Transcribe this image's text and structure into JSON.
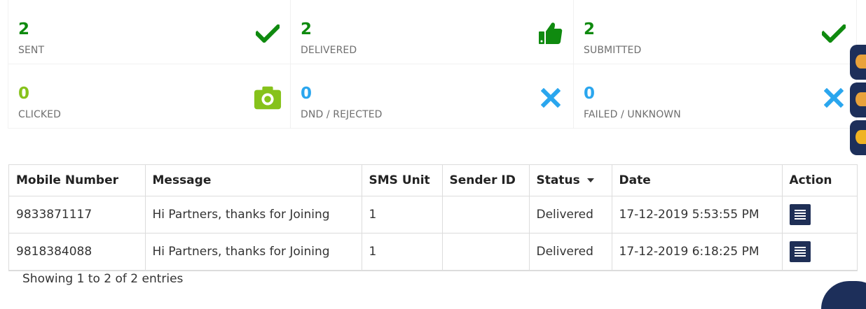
{
  "stats": [
    {
      "value": "2",
      "label": "SENT",
      "icon": "checkmark-icon",
      "color": "#0f8a0f"
    },
    {
      "value": "2",
      "label": "DELIVERED",
      "icon": "thumbs-up-icon",
      "color": "#0f8a0f"
    },
    {
      "value": "2",
      "label": "SUBMITTED",
      "icon": "checkmark-icon",
      "color": "#0f8a0f"
    },
    {
      "value": "0",
      "label": "CLICKED",
      "icon": "camera-icon",
      "color": "#86c21b"
    },
    {
      "value": "0",
      "label": "DND / REJECTED",
      "icon": "x-icon",
      "color": "#2aa6ee"
    },
    {
      "value": "0",
      "label": "FAILED / UNKNOWN",
      "icon": "x-icon",
      "color": "#2aa6ee"
    }
  ],
  "table": {
    "columns": [
      "Mobile Number",
      "Message",
      "SMS Unit",
      "Sender ID",
      "Status",
      "Date",
      "Action"
    ],
    "sorted_column": "Status",
    "rows": [
      {
        "mobile": "9833871117",
        "message": "Hi Partners, thanks for Joining",
        "sms_unit": "1",
        "sender_id": "",
        "status": "Delivered",
        "date": "17-12-2019 5:53:55 PM",
        "action_icon": "details-icon"
      },
      {
        "mobile": "9818384088",
        "message": "Hi Partners, thanks for Joining",
        "sms_unit": "1",
        "sender_id": "",
        "status": "Delivered",
        "date": "17-12-2019 6:18:25 PM",
        "action_icon": "details-icon"
      }
    ],
    "footer_info": "Showing 1 to 2 of 2 entries"
  },
  "colors": {
    "success": "#0f8a0f",
    "clicked": "#86c21b",
    "failed": "#2aa6ee",
    "action_button": "#1f2f56"
  }
}
